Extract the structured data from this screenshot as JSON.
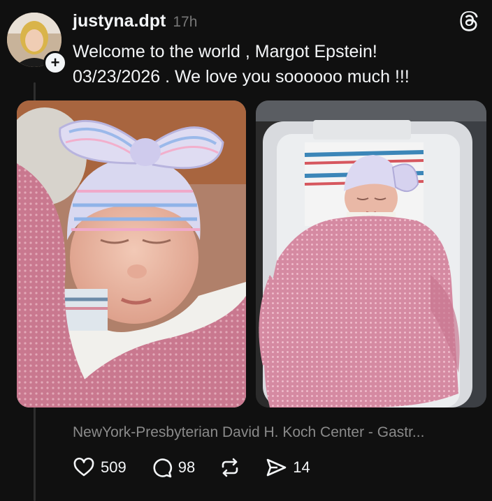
{
  "post": {
    "username": "justyna.dpt",
    "time": "17h",
    "text_line1": "Welcome to the world , Margot Epstein!",
    "text_line2": "03/23/2026 . We love you soooooo much !!!",
    "location": "NewYork-Presbyterian David H. Koch Center - Gastr...",
    "photos": [
      "newborn-closeup-photo",
      "newborn-bassinet-photo"
    ]
  },
  "actions": {
    "likes": "509",
    "replies": "98",
    "shares": "14"
  },
  "icons": [
    "plus-icon",
    "threads-logo-icon",
    "heart-icon",
    "comment-icon",
    "repost-icon",
    "share-icon"
  ],
  "colors": {
    "background": "#101010",
    "text": "#f3f5f7",
    "muted": "#8a8a8a"
  }
}
